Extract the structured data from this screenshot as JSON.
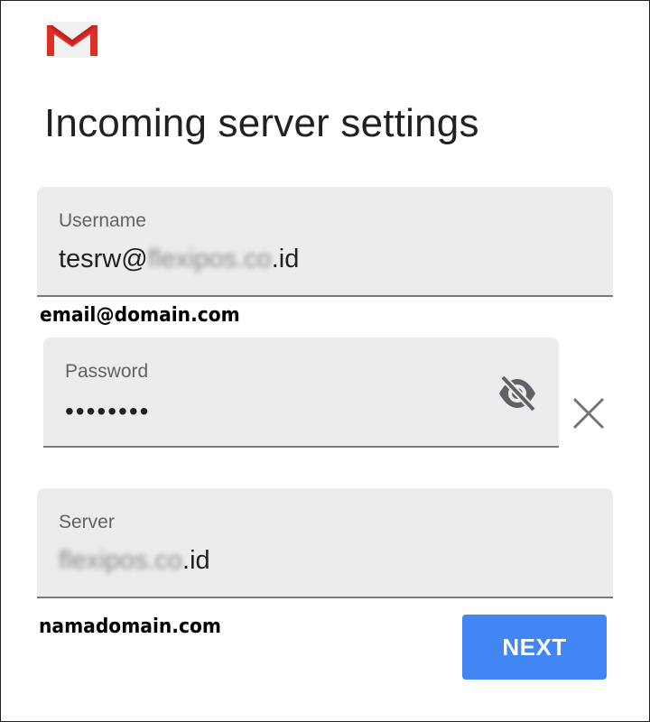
{
  "app": {
    "logo_icon": "gmail-logo-icon",
    "brand_color": "#d93025"
  },
  "page": {
    "title": "Incoming server settings"
  },
  "username": {
    "label": "Username",
    "value_prefix": "tesrw@",
    "value_blurred": "flexipos.co",
    "value_suffix": ".id",
    "annotation": "email@domain.com"
  },
  "password": {
    "label": "Password",
    "value": "••••••••",
    "toggle_icon": "visibility-off-icon",
    "clear_icon": "close-icon"
  },
  "server": {
    "label": "Server",
    "value_blurred": "flexipos.co",
    "value_suffix": ".id",
    "annotation": "namadomain.com"
  },
  "actions": {
    "next_label": "NEXT",
    "next_color": "#4285f4"
  }
}
